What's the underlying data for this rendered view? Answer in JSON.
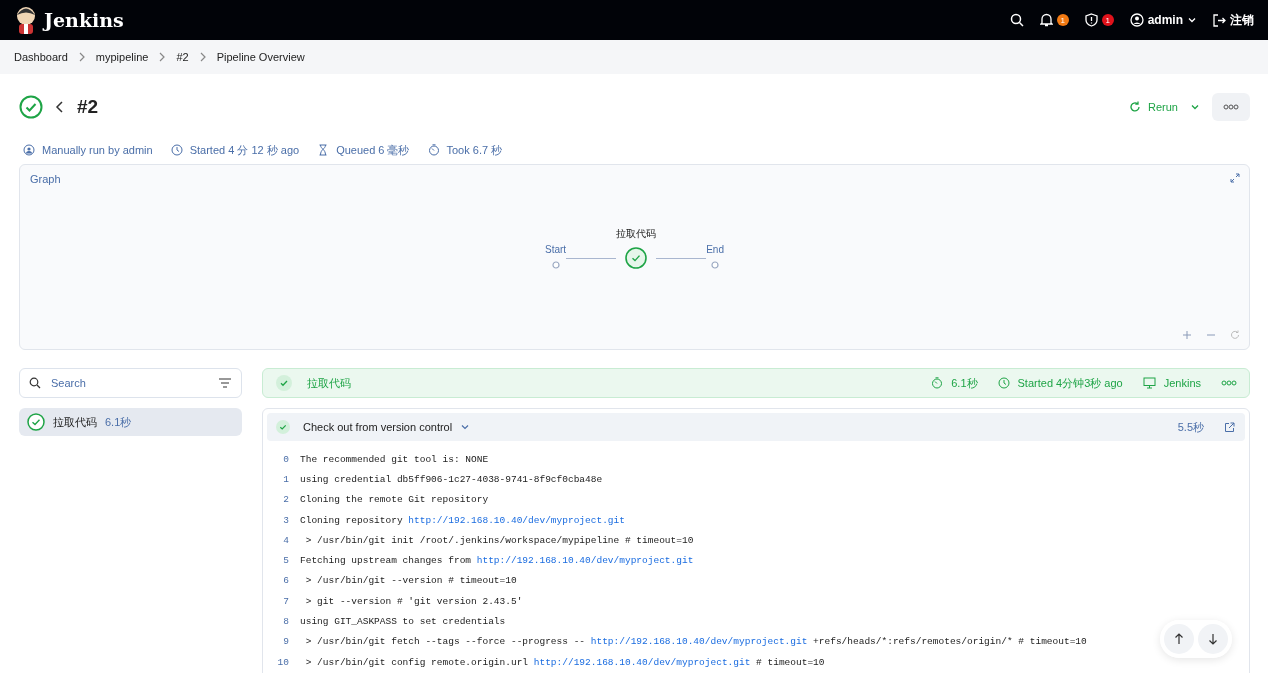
{
  "header": {
    "brand": "Jenkins",
    "notifications_badge": "1",
    "security_badge": "1",
    "user": "admin",
    "logout": "注销"
  },
  "breadcrumbs": [
    "Dashboard",
    "mypipeline",
    "#2",
    "Pipeline Overview"
  ],
  "run": {
    "success": true,
    "title": "#2",
    "rerun": "Rerun",
    "meta": [
      {
        "kind": "user",
        "text": "Manually run by admin"
      },
      {
        "kind": "clock",
        "text": "Started 4 分 12 秒 ago"
      },
      {
        "kind": "hourglass",
        "text": "Queued 6 毫秒"
      },
      {
        "kind": "timer",
        "text": "Took 6.7 秒"
      }
    ]
  },
  "graph": {
    "title": "Graph",
    "nodes": [
      {
        "kind": "start",
        "label": "Start"
      },
      {
        "kind": "stage",
        "label": "拉取代码",
        "success": true
      },
      {
        "kind": "end",
        "label": "End"
      }
    ]
  },
  "search": {
    "placeholder": "Search"
  },
  "stages": [
    {
      "name": "拉取代码",
      "duration": "6.1秒",
      "success": true,
      "selected": true
    }
  ],
  "stage_header": {
    "name": "拉取代码",
    "success": true,
    "duration": "6.1秒",
    "started": "Started 4分钟3秒 ago",
    "agent": "Jenkins"
  },
  "step": {
    "name": "Check out from version control",
    "success": true,
    "expanded": true,
    "duration": "5.5秒"
  },
  "log": [
    {
      "number": "0",
      "parts": [
        {
          "kind": "text",
          "text": "The recommended git tool is: NONE"
        }
      ]
    },
    {
      "number": "1",
      "parts": [
        {
          "kind": "text",
          "text": "using credential db5ff906-1c27-4038-9741-8f9cf0cba48e"
        }
      ]
    },
    {
      "number": "2",
      "parts": [
        {
          "kind": "text",
          "text": "Cloning the remote Git repository"
        }
      ]
    },
    {
      "number": "3",
      "parts": [
        {
          "kind": "text",
          "text": "Cloning repository "
        },
        {
          "kind": "link",
          "text": "http://192.168.10.40/dev/myproject.git"
        }
      ]
    },
    {
      "number": "4",
      "parts": [
        {
          "kind": "text",
          "text": " > /usr/bin/git init /root/.jenkins/workspace/mypipeline # timeout=10"
        }
      ]
    },
    {
      "number": "5",
      "parts": [
        {
          "kind": "text",
          "text": "Fetching upstream changes from "
        },
        {
          "kind": "link",
          "text": "http://192.168.10.40/dev/myproject.git"
        }
      ]
    },
    {
      "number": "6",
      "parts": [
        {
          "kind": "text",
          "text": " > /usr/bin/git --version # timeout=10"
        }
      ]
    },
    {
      "number": "7",
      "parts": [
        {
          "kind": "text",
          "text": " > git --version # 'git version 2.43.5'"
        }
      ]
    },
    {
      "number": "8",
      "parts": [
        {
          "kind": "text",
          "text": "using GIT_ASKPASS to set credentials"
        }
      ]
    },
    {
      "number": "9",
      "parts": [
        {
          "kind": "text",
          "text": " > /usr/bin/git fetch --tags --force --progress -- "
        },
        {
          "kind": "link",
          "text": "http://192.168.10.40/dev/myproject.git"
        },
        {
          "kind": "text",
          "text": " +refs/heads/*:refs/remotes/origin/* # timeout=10"
        }
      ]
    },
    {
      "number": "10",
      "parts": [
        {
          "kind": "text",
          "text": " > /usr/bin/git config remote.origin.url "
        },
        {
          "kind": "link",
          "text": "http://192.168.10.40/dev/myproject.git"
        },
        {
          "kind": "text",
          "text": " # timeout=10"
        }
      ]
    }
  ]
}
